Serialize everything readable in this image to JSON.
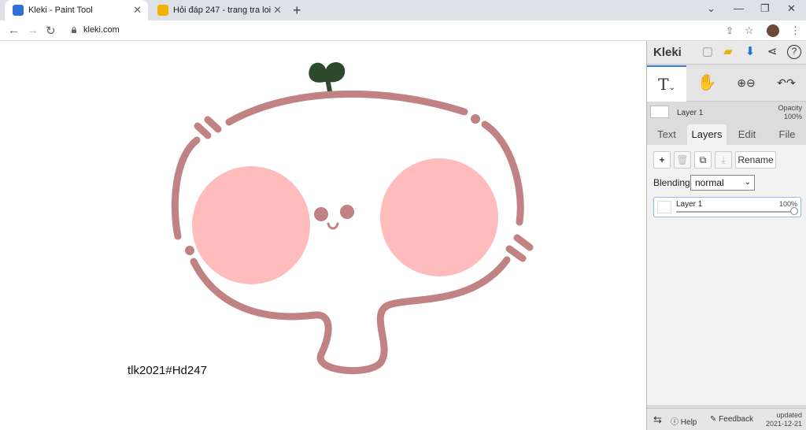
{
  "browser": {
    "tabs": [
      {
        "title": "Kleki - Paint Tool",
        "active": true
      },
      {
        "title": "Hỏi đáp 247 - trang tra loi",
        "active": false
      }
    ],
    "new_tab": "+",
    "url": "kleki.com",
    "controls": {
      "minimize": "⌄",
      "restore": "—",
      "maximize": "❐",
      "close": "✕"
    }
  },
  "canvas": {
    "signature": "tlk2021#Hd247",
    "colors": {
      "outline": "#c08282",
      "cheeks": "#ffbcbc",
      "sprout": "#2e4a2e"
    }
  },
  "panel": {
    "logo": "Kleki",
    "layer_name": "Layer 1",
    "opacity_label": "Opacity",
    "opacity_value": "100%",
    "tabs": [
      "Text",
      "Layers",
      "Edit",
      "File"
    ],
    "active_tab": "Layers",
    "buttons": {
      "add": "+",
      "rename": "Rename"
    },
    "blending_label": "Blending",
    "blending_value": "normal",
    "layer_item": {
      "name": "Layer 1",
      "opacity": "100%"
    },
    "bottom": {
      "help": "Help",
      "feedback": "Feedback",
      "updated_label": "updated",
      "updated_date": "2021-12-21"
    }
  }
}
